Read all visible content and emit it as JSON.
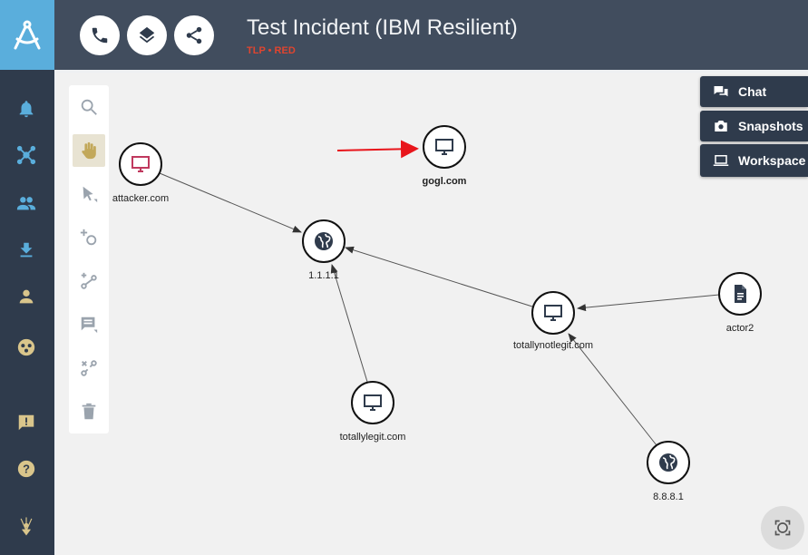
{
  "header": {
    "title": "Test Incident (IBM Resilient)",
    "tlp": "TLP • RED",
    "buttons": [
      {
        "name": "phone-button",
        "icon": "phone-icon"
      },
      {
        "name": "layers-button",
        "icon": "layers-icon"
      },
      {
        "name": "share-button",
        "icon": "share-icon"
      }
    ]
  },
  "sidebar": {
    "logo_icon": "compass-logo-icon",
    "items": [
      {
        "name": "notifications",
        "icon": "bell-icon"
      },
      {
        "name": "graph",
        "icon": "graph-icon"
      },
      {
        "name": "users",
        "icon": "people-icon"
      },
      {
        "name": "download",
        "icon": "download-icon"
      },
      {
        "name": "profile",
        "icon": "person-icon"
      },
      {
        "name": "integrations",
        "icon": "cluster-icon"
      },
      {
        "name": "feedback",
        "icon": "feedback-icon"
      },
      {
        "name": "help",
        "icon": "help-icon"
      },
      {
        "name": "team",
        "icon": "crest-icon"
      }
    ]
  },
  "toolbox": {
    "tools": [
      "search-icon",
      "hand-icon",
      "select-icon",
      "add-node-icon",
      "add-edge-icon",
      "comment-icon",
      "disconnect-icon",
      "trash-icon"
    ],
    "active": "hand-icon"
  },
  "panel": {
    "chat_label": "Chat",
    "snapshots_label": "Snapshots",
    "workspace_label": "Workspace"
  },
  "graph": {
    "nodes": {
      "attacker": {
        "label": "attacker.com",
        "icon": "monitor-icon",
        "color": "#c0395e"
      },
      "gogl": {
        "label": "gogl.com",
        "icon": "monitor-icon"
      },
      "ip1111": {
        "label": "1.1.1.1",
        "icon": "globe-icon"
      },
      "totallynotlegit": {
        "label": "totallynotlegit.com",
        "icon": "monitor-icon"
      },
      "actor2": {
        "label": "actor2",
        "icon": "document-icon"
      },
      "totallylegit": {
        "label": "totallylegit.com",
        "icon": "monitor-icon"
      },
      "ip8888": {
        "label": "8.8.8.1",
        "icon": "globe-icon"
      }
    },
    "edges": [
      [
        "attacker",
        "ip1111"
      ],
      [
        "totallynotlegit",
        "ip1111"
      ],
      [
        "totallylegit",
        "ip1111"
      ],
      [
        "actor2",
        "totallynotlegit"
      ],
      [
        "ip8888",
        "totallynotlegit"
      ]
    ],
    "annotation_arrow_color": "#e8151b"
  }
}
